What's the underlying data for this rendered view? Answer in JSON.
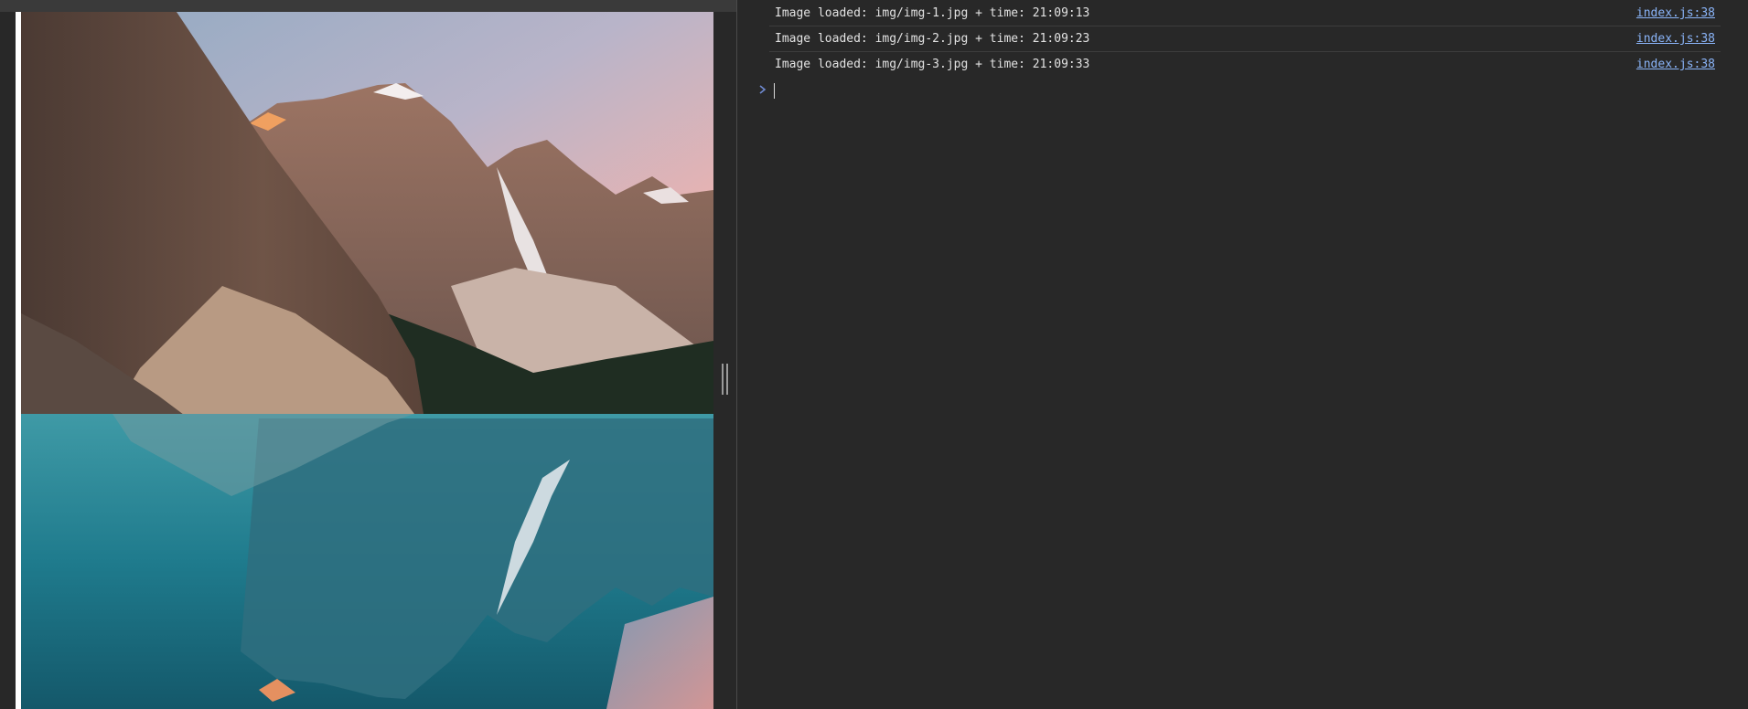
{
  "preview": {
    "image_alt": "Mountain lake landscape"
  },
  "console": {
    "messages": [
      {
        "text": "Image loaded: img/img-1.jpg + time: 21:09:13",
        "source": "index.js:38"
      },
      {
        "text": "Image loaded: img/img-2.jpg + time: 21:09:23",
        "source": "index.js:38"
      },
      {
        "text": "Image loaded: img/img-3.jpg + time: 21:09:33",
        "source": "index.js:38"
      }
    ],
    "prompt_icon": "chevron-right-icon"
  },
  "colors": {
    "background": "#282828",
    "link": "#8ab4f8",
    "text": "#e2e2e2"
  }
}
